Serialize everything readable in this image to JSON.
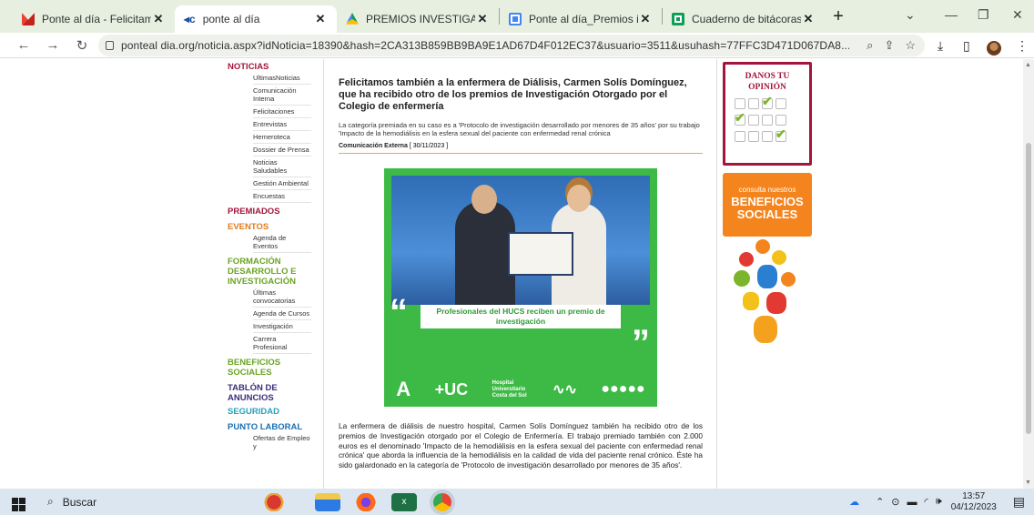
{
  "browser": {
    "tabs": [
      {
        "title": "Ponte al día - Felicitamos",
        "active": false,
        "icon": "gmail-icon"
      },
      {
        "title": "ponte al día",
        "active": true,
        "icon": "pd-icon"
      },
      {
        "title": "PREMIOS INVESTIGACIÓ",
        "active": false,
        "icon": "drive-icon"
      },
      {
        "title": "Ponte al día_Premios inv",
        "active": false,
        "icon": "docs-icon"
      },
      {
        "title": "Cuaderno de bitácoras R",
        "active": false,
        "icon": "sheets-icon"
      }
    ],
    "new_tab": "+",
    "url": "ponteal dia.org/noticia.aspx?idNoticia=18390&hash=2CA313B859BB9BA9E1AD67D4F012EC37&usuario=3511&usuhash=77FFC3D471D067DA8..."
  },
  "sidebar": {
    "noticias": "NOTICIAS",
    "noticias_items": [
      "UltimasNoticias",
      "Comunicación Interna",
      "Felicitaciones",
      "Entrevistas",
      "Hemeroteca",
      "Dossier de Prensa",
      "Noticias Saludables",
      "Gestión Ambiental",
      "Encuestas"
    ],
    "premiados": "PREMIADOS",
    "eventos": "EVENTOS",
    "eventos_items": [
      "Agenda de Eventos"
    ],
    "formacion": "FORMACIÓN DESARROLLO E INVESTIGACIÓN",
    "formacion_items": [
      "Últimas convocatorias",
      "Agenda de Cursos",
      "Investigación",
      "Carrera Profesional"
    ],
    "beneficios": "BENEFICIOS SOCIALES",
    "tablon": "TABLÓN DE ANUNCIOS",
    "seguridad": "SEGURIDAD",
    "punto_laboral": "PUNTO LABORAL",
    "punto_items": [
      "Ofertas de Empleo y"
    ]
  },
  "article": {
    "headline": "Felicitamos también a la enfermera de Diálisis, Carmen Solís Domínguez, que ha recibido otro de los premios de Investigación Otorgado por el Colegio de enfermería",
    "summary": "La categoría premiada en su caso es a 'Protocolo de investigación desarrollado por menores de 35 años' por su trabajo 'Impacto de la hemodiálisis en la esfera sexual del paciente con enfermedad renal crónica",
    "category": "Comunicación Externa",
    "date": "[ 30/11/2023 ]",
    "image_caption": "Profesionales del HUCS reciben un premio de investigación",
    "logo_hucs": "+UC",
    "logo_hospital": "Hospital Universitario Costa del Sol",
    "body": "La enfermera de diálisis de nuestro hospital, Carmen Solís Domínguez también ha recibido otro de los premios de Investigación otorgado por el Colegio de Enfermería. El trabajo premiado también con 2.000 euros es  el denominado 'Impacto de la hemodiálisis en la esfera sexual del paciente con enfermedad renal crónica' que aborda la influencia de la hemodiálisis en la calidad de vida del paciente renal crónico. Éste ha sido galardonado en la categoría de 'Protocolo de investigación desarrollado por menores de 35 años'."
  },
  "right": {
    "opinion_title": "DANOS TU OPINIÓN",
    "benef_small": "consulta nuestros",
    "benef_big": "BENEFICIOS SOCIALES"
  },
  "taskbar": {
    "search": "Buscar",
    "time": "13:57",
    "date": "04/12/2023"
  }
}
